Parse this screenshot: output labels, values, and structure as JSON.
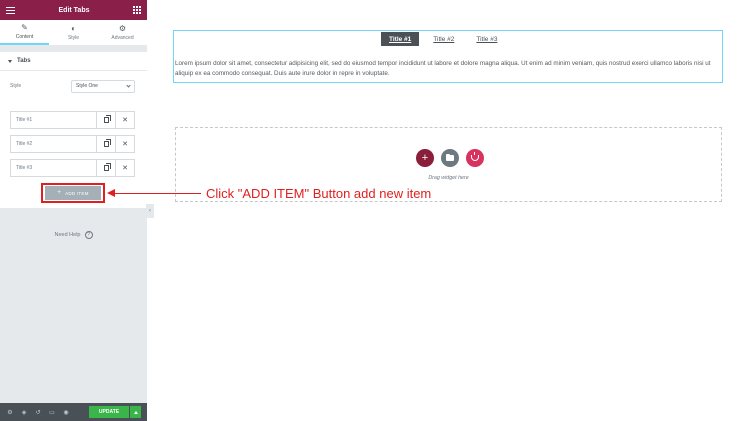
{
  "panel": {
    "title": "Edit Tabs",
    "tabs": [
      {
        "label": "Content",
        "icon": "pencil-icon"
      },
      {
        "label": "Style",
        "icon": "half-circle-icon"
      },
      {
        "label": "Advanced",
        "icon": "gear-icon"
      }
    ],
    "section_title": "Tabs",
    "style_label": "Style",
    "style_value": "Style One",
    "items": [
      {
        "title": "Title #1"
      },
      {
        "title": "Title #2"
      },
      {
        "title": "Title #3"
      }
    ],
    "add_item_label": "ADD ITEM",
    "need_help": "Need Help",
    "footer": {
      "update_label": "UPDATE"
    }
  },
  "canvas": {
    "tab_titles": [
      "Title #1",
      "Title #2",
      "Title #3"
    ],
    "active_tab": 0,
    "tab_content": "Lorem ipsum dolor sit amet, consectetur adipisicing elit, sed do eiusmod tempor incididunt ut labore et dolore magna aliqua. Ut enim ad minim veniam, quis nostrud exerci ullamco laboris nisi ut aliquip ex ea commodo consequat. Duis aute irure dolor in repre in voluptate.",
    "drag_text": "Drag widget here"
  },
  "annotation": {
    "text": "Click \"ADD ITEM\" Button add new item",
    "color": "#e02020"
  },
  "colors": {
    "header": "#8a1f4a",
    "update": "#39b54a",
    "active_tab_underline": "#71d7f7"
  }
}
